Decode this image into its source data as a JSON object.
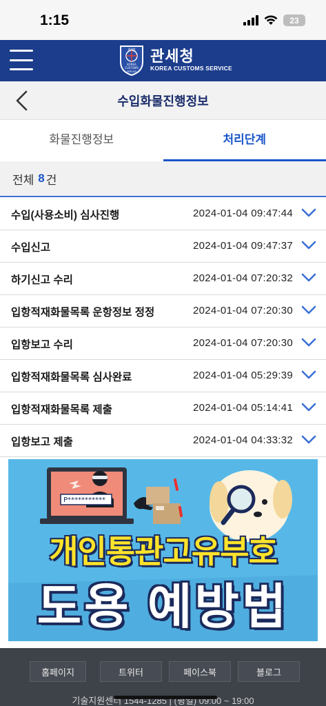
{
  "status_bar": {
    "time": "1:15",
    "battery": "23"
  },
  "header": {
    "logo_kr": "관세청",
    "logo_en": "KOREA CUSTOMS SERVICE",
    "emblem_text": "관세청",
    "emblem_sub1": "KOREA",
    "emblem_sub2": "CUSTOMS",
    "emblem_sub3": "SERVICE"
  },
  "titlebar": {
    "title": "수입화물진행정보"
  },
  "tabs": [
    {
      "label": "화물진행정보",
      "active": false
    },
    {
      "label": "처리단계",
      "active": true
    }
  ],
  "count": {
    "prefix": "전체",
    "number": "8",
    "suffix": "건"
  },
  "steps": [
    {
      "name": "수입(사용소비) 심사진행",
      "time": "2024-01-04 09:47:44"
    },
    {
      "name": "수입신고",
      "time": "2024-01-04 09:47:37"
    },
    {
      "name": "하기신고 수리",
      "time": "2024-01-04 07:20:32"
    },
    {
      "name": "입항적재화물목록 운항정보 정정",
      "time": "2024-01-04 07:20:30"
    },
    {
      "name": "입항보고 수리",
      "time": "2024-01-04 07:20:30"
    },
    {
      "name": "입항적재화물목록 심사완료",
      "time": "2024-01-04 05:29:39"
    },
    {
      "name": "입항적재화물목록 제출",
      "time": "2024-01-04 05:14:41"
    },
    {
      "name": "입항보고 제출",
      "time": "2024-01-04 04:33:32"
    }
  ],
  "banner": {
    "line1": "개인통관고유부호",
    "line2": "도용 예방법",
    "password_text": "P***********"
  },
  "footer": {
    "links": [
      "홈페이지",
      "트위터",
      "페이스북",
      "블로그"
    ],
    "info": "기술지원센터 1544-1285 | (평일) 09:00 ~ 19:00"
  },
  "colors": {
    "header_bg": "#1c3d8c",
    "accent": "#1a55c8",
    "footer_bg": "#3e4249"
  }
}
